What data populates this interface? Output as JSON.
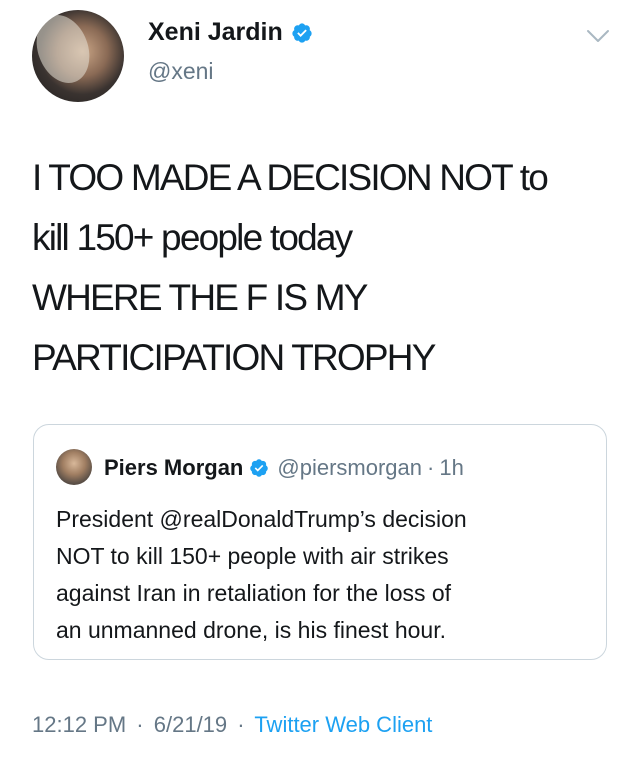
{
  "author": {
    "display_name": "Xeni Jardin",
    "handle": "@xeni",
    "verified": true
  },
  "tweet": {
    "text": "I TOO MADE A DECISION NOT to\nkill 150+ people today\nWHERE THE F IS MY\nPARTICIPATION TROPHY"
  },
  "quoted_tweet": {
    "display_name": "Piers Morgan",
    "handle": "@piersmorgan",
    "separator": "·",
    "time_ago": "1h",
    "text": "President @realDonaldTrump’s  decision\nNOT to kill 150+ people with air strikes\nagainst Iran in retaliation for the loss of\nan unmanned drone, is his finest hour."
  },
  "meta": {
    "time": "12:12 PM",
    "separator": "·",
    "date": "6/21/19",
    "source": "Twitter Web Client"
  },
  "colors": {
    "verified_blue": "#1da1f2",
    "secondary_text": "#657786",
    "link_blue": "#1da1f2",
    "border": "#ccd6dd"
  },
  "icons": {
    "verified": "verified-badge-icon",
    "menu": "chevron-down-icon"
  }
}
